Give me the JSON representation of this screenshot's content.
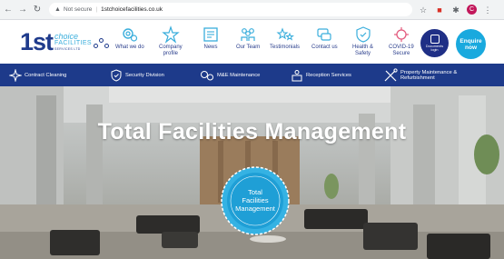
{
  "browser": {
    "security_label": "Not secure",
    "url": "1stchoicefacilities.co.uk",
    "profile_initial": "C"
  },
  "logo": {
    "main": "1st",
    "line1": "choice",
    "line2": "FACILITIES",
    "line3": "SERVICES LTD"
  },
  "nav": [
    {
      "label": "What we do",
      "icon": "cogs-icon"
    },
    {
      "label": "Company\nprofile",
      "icon": "stars-icon"
    },
    {
      "label": "News",
      "icon": "newspaper-icon"
    },
    {
      "label": "Our Team",
      "icon": "team-icon"
    },
    {
      "label": "Testimonials",
      "icon": "stars-sparkle-icon"
    },
    {
      "label": "Contact us",
      "icon": "chat-icon"
    },
    {
      "label": "Health &\nSafety",
      "icon": "shield-icon"
    },
    {
      "label": "COVID-19\nSecure",
      "icon": "virus-icon"
    }
  ],
  "buttons": {
    "documents": "Documents\nlogin",
    "enquire": "Enquire\nnow"
  },
  "services": [
    {
      "label": "Contract Cleaning",
      "icon": "sparkle-icon"
    },
    {
      "label": "Security Division",
      "icon": "shield-check-icon"
    },
    {
      "label": "M&E Maintenance",
      "icon": "gears-icon"
    },
    {
      "label": "Reception Services",
      "icon": "reception-icon"
    },
    {
      "label": "Property Maintenance &\nRefurbishment",
      "icon": "tools-icon"
    }
  ],
  "hero": {
    "title": "Total Facilities Management",
    "badge": "Total\nFacilities\nManagement"
  },
  "colors": {
    "brand_navy": "#1d3a8a",
    "brand_blue": "#19a9de",
    "browser_bg": "#f1f3f4"
  }
}
